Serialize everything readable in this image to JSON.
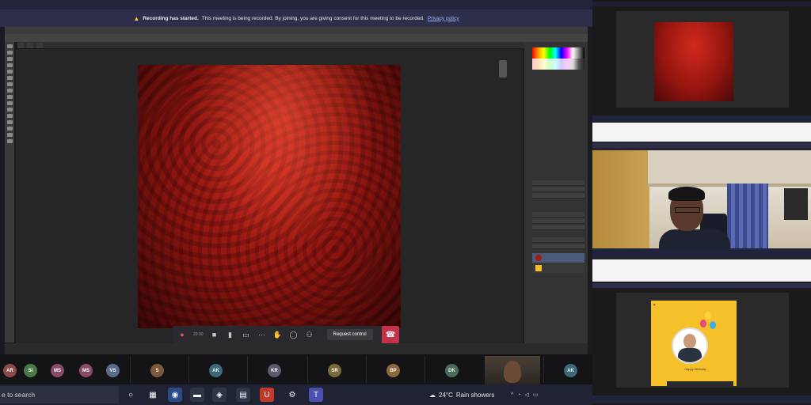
{
  "banner": {
    "title": "Recording has started.",
    "message": "This meeting is being recorded. By joining, you are giving consent for this meeting to be recorded.",
    "link": "Privacy policy"
  },
  "meeting_controls": {
    "timer": "20:00",
    "request_control_label": "Request control",
    "icons": [
      "record-icon",
      "camera-icon",
      "mic-icon",
      "share-icon",
      "more-icon",
      "hand-icon",
      "chat-icon",
      "people-icon",
      "leave-icon"
    ]
  },
  "participants": [
    {
      "initials": "AR",
      "name": "",
      "color": "#8a4a4a"
    },
    {
      "initials": "SI",
      "name": "",
      "color": "#4a7a4a"
    },
    {
      "initials": "MS",
      "name": "",
      "color": "#8a4a6a"
    },
    {
      "initials": "MS",
      "name": "",
      "color": "#8a4a6a"
    },
    {
      "initials": "VS",
      "name": "",
      "color": "#5a6a8a"
    },
    {
      "initials": "S",
      "name": "",
      "color": "#7a5a3a"
    },
    {
      "initials": "AK",
      "name": "",
      "color": "#3a6a7a"
    },
    {
      "initials": "KR",
      "name": "",
      "color": "#5a5a6a"
    },
    {
      "initials": "SR",
      "name": "",
      "color": "#7a6a3a"
    },
    {
      "initials": "BP",
      "name": "",
      "color": "#8a6a3a"
    },
    {
      "initials": "DK",
      "name": "",
      "color": "#4a6a5a"
    },
    {
      "initials": "AK",
      "name": "",
      "color": "#3a6a7a"
    }
  ],
  "taskbar": {
    "search_placeholder": "e to search",
    "weather": "24°C",
    "weather_desc": "Rain showers"
  },
  "right_panels": {
    "card_text": "Happy Birthday"
  },
  "colors": {
    "accent_red": "#c4314b",
    "banner_bg": "#2d2f4a",
    "taskbar_bg": "#1f2333"
  }
}
